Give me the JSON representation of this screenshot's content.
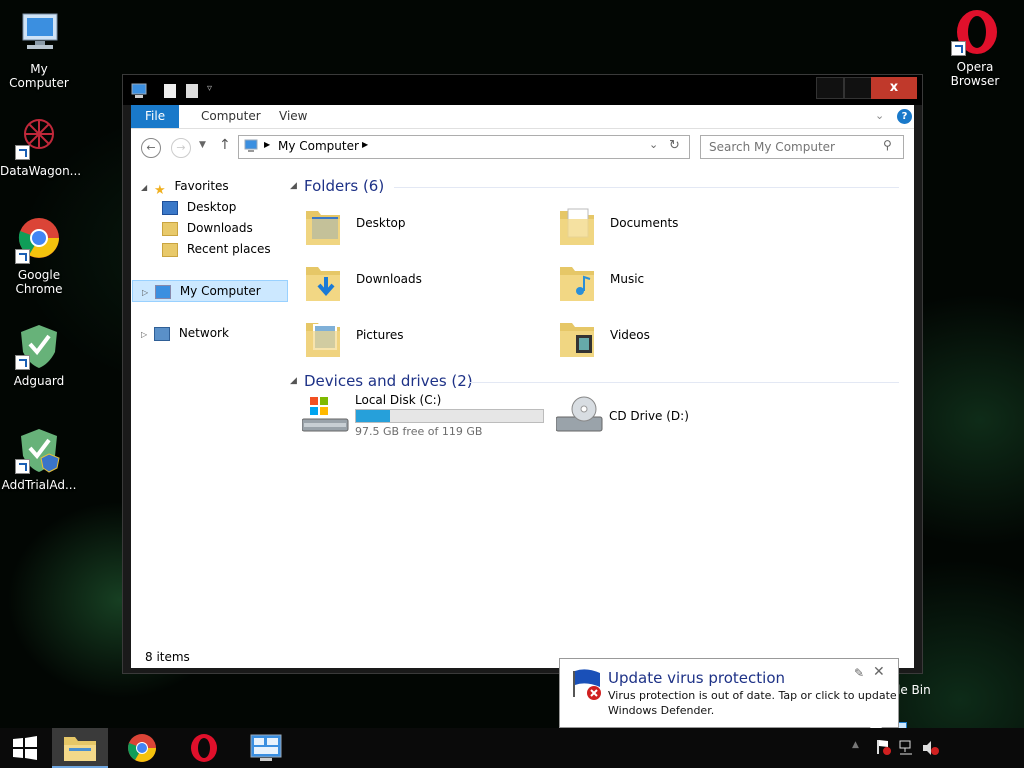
{
  "desktop": {
    "icons": [
      {
        "label": "My Computer"
      },
      {
        "label": "DataWagon..."
      },
      {
        "label": "Google Chrome"
      },
      {
        "label": "Adguard"
      },
      {
        "label": "AddTrialAd..."
      },
      {
        "label": "Opera Browser"
      }
    ],
    "partial_label": "le Bin"
  },
  "window": {
    "close_label": "x",
    "ribbon_tabs": [
      "File",
      "Computer",
      "View"
    ],
    "address": {
      "location": "My Computer"
    },
    "search": {
      "placeholder": "Search My Computer"
    },
    "nav": {
      "favorites": "Favorites",
      "desktop": "Desktop",
      "downloads": "Downloads",
      "recent": "Recent places",
      "my_computer": "My Computer",
      "network": "Network"
    },
    "folders_header": "Folders (6)",
    "folders": [
      "Desktop",
      "Documents",
      "Downloads",
      "Music",
      "Pictures",
      "Videos"
    ],
    "devices_header": "Devices and drives (2)",
    "drives": [
      {
        "name": "Local Disk (C:)",
        "free_text": "97.5 GB free of 119 GB",
        "used_fraction": 0.18
      },
      {
        "name": "CD Drive (D:)"
      }
    ],
    "status": "8 items"
  },
  "toast": {
    "title": "Update virus protection",
    "body_line1": "Virus protection is out of date. Tap or click to update",
    "body_line2": "Windows Defender."
  },
  "colors": {
    "accent": "#1979ca",
    "drive_bar": "#26a0da",
    "close": "#c0392b"
  }
}
